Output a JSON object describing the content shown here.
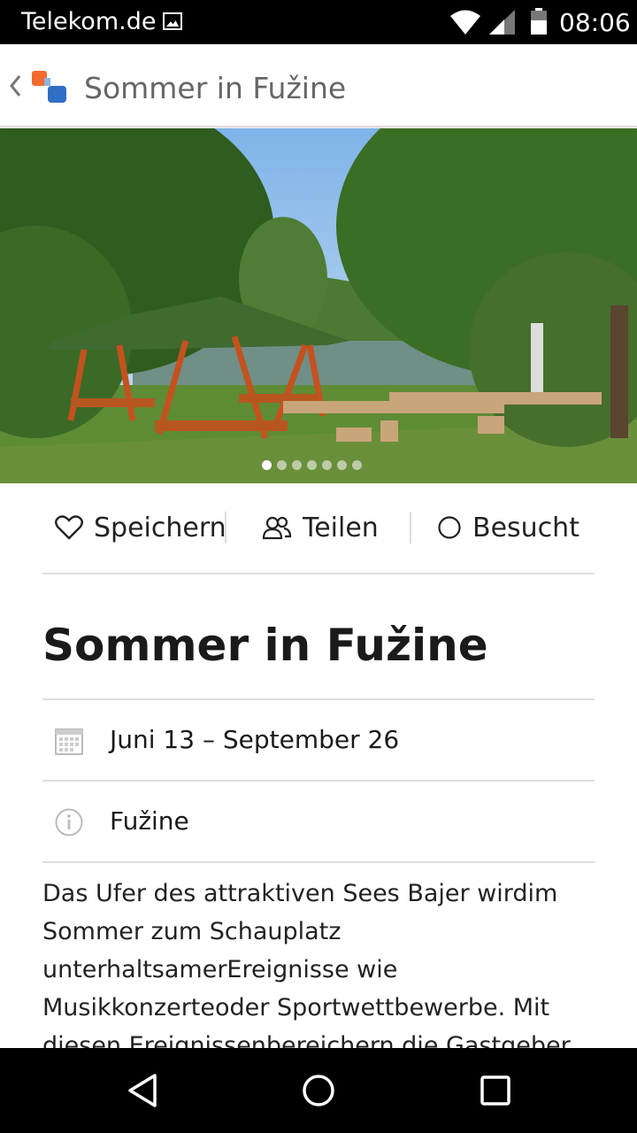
{
  "status_bar": {
    "carrier": "Telekom.de",
    "time": "08:06"
  },
  "app_bar": {
    "title": "Sommer in Fužine"
  },
  "gallery": {
    "total_images": 7,
    "active_index": 0
  },
  "actions": {
    "save": "Speichern",
    "share": "Teilen",
    "visited": "Besucht"
  },
  "event": {
    "title": "Sommer in Fužine",
    "dates": "Juni 13 – September 26",
    "location": "Fužine",
    "description": "Das Ufer des attraktiven Sees Bajer wirdim Sommer zum Schauplatz unterhaltsamerEreignisse wie Musikkonzerteoder Sportwettbewerbe. Mit diesen Ereignissenbereichern die Gastgeber"
  }
}
